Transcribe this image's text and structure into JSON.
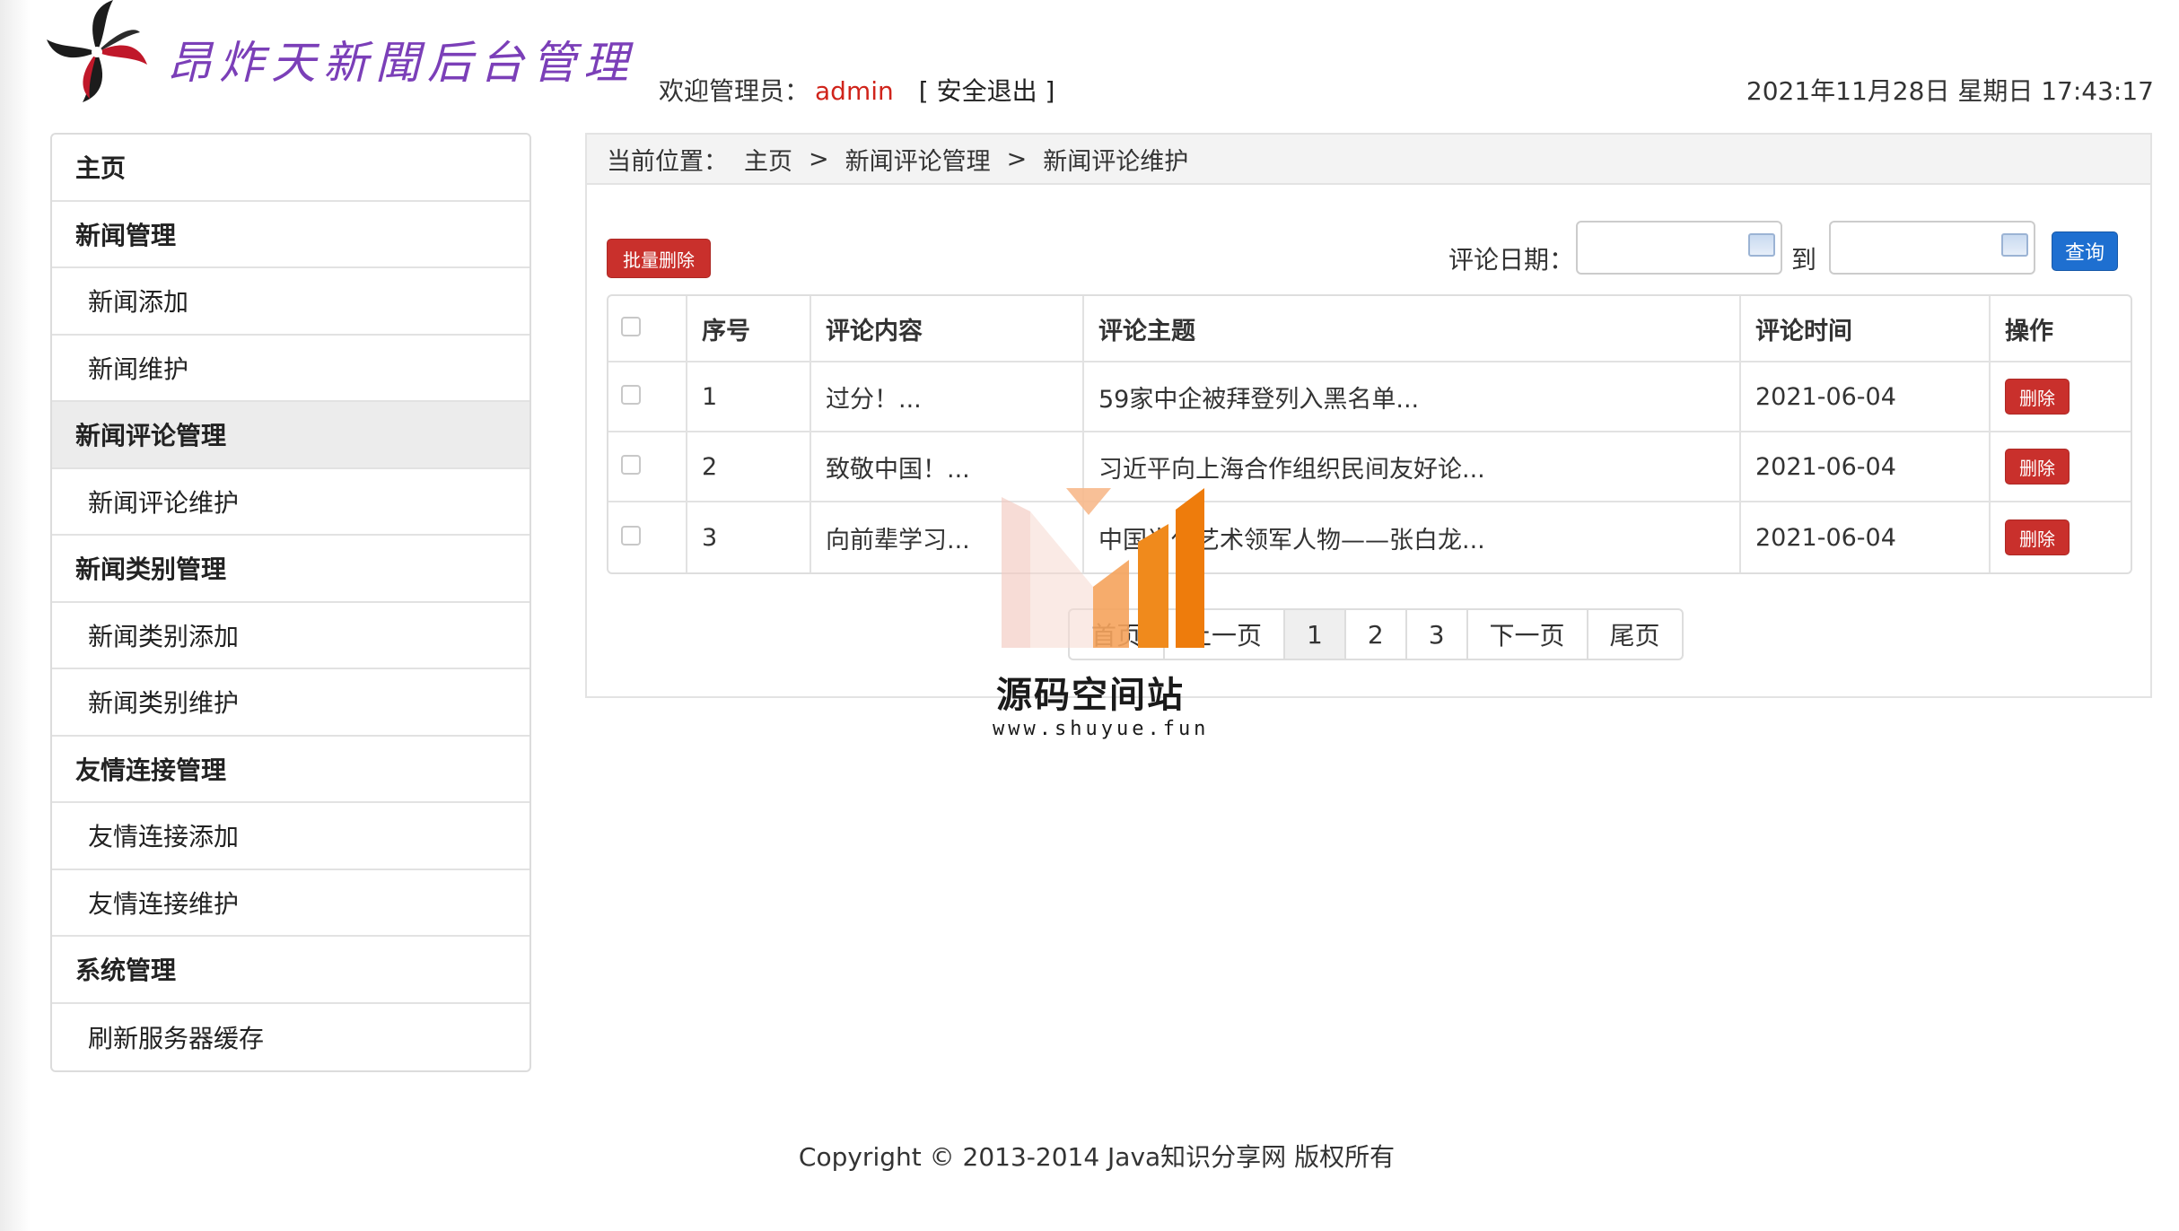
{
  "header": {
    "brand": "昂炸天新聞后台管理",
    "welcome_label": "欢迎管理员：",
    "username": "admin",
    "logout": "[ 安全退出 ]",
    "datetime": "2021年11月28日 星期日 17:43:17"
  },
  "sidebar": {
    "items": [
      {
        "label": "主页",
        "type": "group"
      },
      {
        "label": "新闻管理",
        "type": "group"
      },
      {
        "label": "新闻添加",
        "type": "child"
      },
      {
        "label": "新闻维护",
        "type": "child"
      },
      {
        "label": "新闻评论管理",
        "type": "group",
        "active": true
      },
      {
        "label": "新闻评论维护",
        "type": "child"
      },
      {
        "label": "新闻类别管理",
        "type": "group"
      },
      {
        "label": "新闻类别添加",
        "type": "child"
      },
      {
        "label": "新闻类别维护",
        "type": "child"
      },
      {
        "label": "友情连接管理",
        "type": "group"
      },
      {
        "label": "友情连接添加",
        "type": "child"
      },
      {
        "label": "友情连接维护",
        "type": "child"
      },
      {
        "label": "系统管理",
        "type": "group"
      },
      {
        "label": "刷新服务器缓存",
        "type": "child"
      }
    ]
  },
  "breadcrumb": {
    "label": "当前位置：",
    "items": [
      "主页",
      ">",
      "新闻评论管理",
      ">",
      "新闻评论维护"
    ]
  },
  "toolbar": {
    "batch_delete": "批量删除",
    "date_label": "评论日期：",
    "to_label": "到",
    "query": "查询",
    "date_from_value": "",
    "date_to_value": ""
  },
  "table": {
    "columns": [
      "",
      "序号",
      "评论内容",
      "评论主题",
      "评论时间",
      "操作"
    ],
    "rows": [
      {
        "no": "1",
        "content": "过分！...",
        "topic": "59家中企被拜登列入黑名单...",
        "time": "2021-06-04",
        "action": "删除"
      },
      {
        "no": "2",
        "content": "致敬中国！...",
        "topic": "习近平向上海合作组织民间友好论...",
        "time": "2021-06-04",
        "action": "删除"
      },
      {
        "no": "3",
        "content": "向前辈学习...",
        "topic": "中国当代艺术领军人物——张白龙...",
        "time": "2021-06-04",
        "action": "删除"
      }
    ]
  },
  "pager": {
    "first": "首页",
    "prev": "上一页",
    "pages": [
      "1",
      "2",
      "3"
    ],
    "current": "1",
    "next": "下一页",
    "last": "尾页"
  },
  "watermark": {
    "title": "源码空间站",
    "url": "www.shuyue.fun"
  },
  "footer": {
    "copyright": "Copyright © 2013-2014 Java知识分享网 版权所有"
  },
  "colors": {
    "danger": "#c9302c",
    "primary": "#1e6fd0",
    "brand_text": "#7b3fb8",
    "username": "#d0241b"
  }
}
